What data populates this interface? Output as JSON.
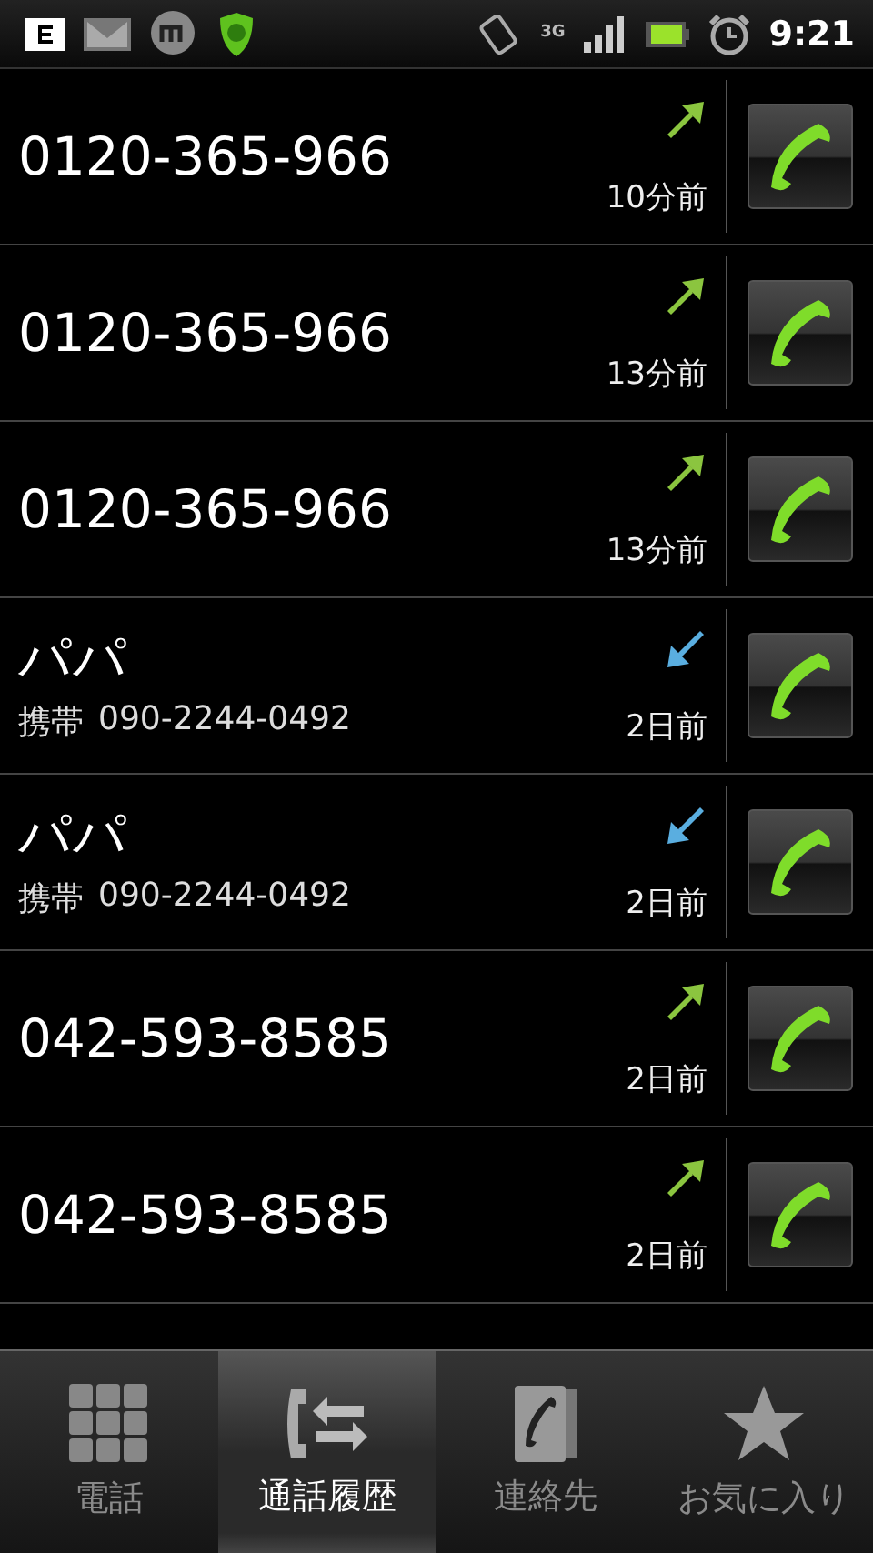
{
  "status_bar": {
    "time": "9:21",
    "network": "3G"
  },
  "calls": [
    {
      "number": "0120-365-966",
      "kind": "outgoing",
      "time": "10分前"
    },
    {
      "number": "0120-365-966",
      "kind": "outgoing",
      "time": "13分前"
    },
    {
      "number": "0120-365-966",
      "kind": "outgoing",
      "time": "13分前"
    },
    {
      "name": "パパ",
      "label": "携帯",
      "number": "090-2244-0492",
      "kind": "incoming",
      "time": "2日前"
    },
    {
      "name": "パパ",
      "label": "携帯",
      "number": "090-2244-0492",
      "kind": "incoming",
      "time": "2日前"
    },
    {
      "number": "042-593-8585",
      "kind": "outgoing",
      "time": "2日前"
    },
    {
      "number": "042-593-8585",
      "kind": "outgoing",
      "time": "2日前"
    }
  ],
  "tabs": [
    {
      "label": "電話",
      "kind": "dialpad",
      "selected": false
    },
    {
      "label": "通話履歴",
      "kind": "history",
      "selected": true
    },
    {
      "label": "連絡先",
      "kind": "contacts",
      "selected": false
    },
    {
      "label": "お気に入り",
      "kind": "favorites",
      "selected": false
    }
  ]
}
